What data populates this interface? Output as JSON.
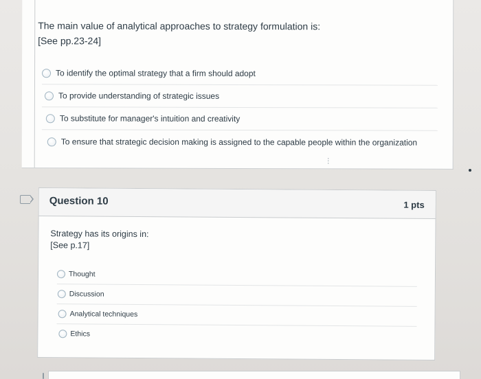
{
  "question9": {
    "prompt_line1": "The main value of analytical approaches to strategy formulation is:",
    "prompt_line2": "[See pp.23-24]",
    "answers": [
      "To identify the optimal strategy that a firm should adopt",
      "To provide understanding of strategic issues",
      "To substitute for manager's intuition and creativity",
      "To ensure that strategic decision making is assigned to the capable people within the organization"
    ]
  },
  "question10": {
    "title": "Question 10",
    "points": "1 pts",
    "prompt_line1": "Strategy has its origins in:",
    "prompt_line2": "[See p.17]",
    "answers": [
      "Thought",
      "Discussion",
      "Analytical techniques",
      "Ethics"
    ]
  },
  "icons": {
    "flag": "flag-outline-icon",
    "radio": "radio-button-unselected-icon",
    "resize": "drag-handle-dots-icon"
  },
  "colors": {
    "text": "#2d3b45",
    "card_border": "#c9ccce",
    "header_bg": "#f5f5f5",
    "radio_border": "#9fb3c0"
  }
}
